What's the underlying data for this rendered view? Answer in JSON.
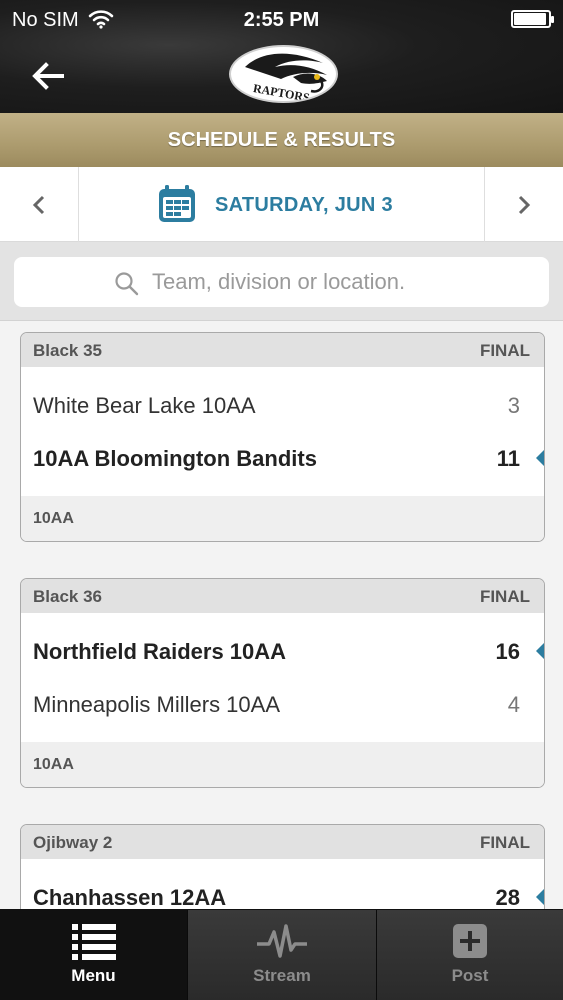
{
  "status_bar": {
    "carrier": "No SIM",
    "time": "2:55 PM",
    "battery_level": 0.9
  },
  "header": {
    "logo_text": "RAPTORS"
  },
  "title": "SCHEDULE & RESULTS",
  "date_nav": {
    "label": "SATURDAY, JUN 3"
  },
  "search": {
    "placeholder": "Team, division or location."
  },
  "games": [
    {
      "venue": "Black 35",
      "status": "FINAL",
      "division": "10AA",
      "teams": [
        {
          "name": "White Bear Lake 10AA",
          "score": "3",
          "winner": false
        },
        {
          "name": "10AA Bloomington Bandits",
          "score": "11",
          "winner": true
        }
      ]
    },
    {
      "venue": "Black 36",
      "status": "FINAL",
      "division": "10AA",
      "teams": [
        {
          "name": "Northfield Raiders 10AA",
          "score": "16",
          "winner": true
        },
        {
          "name": "Minneapolis Millers 10AA",
          "score": "4",
          "winner": false
        }
      ]
    },
    {
      "venue": "Ojibway 2",
      "status": "FINAL",
      "division": "",
      "teams": [
        {
          "name": "Chanhassen 12AA",
          "score": "28",
          "winner": true
        }
      ]
    }
  ],
  "tabs": [
    {
      "label": "Menu",
      "icon": "menu-list-icon",
      "active": true
    },
    {
      "label": "Stream",
      "icon": "pulse-icon",
      "active": false
    },
    {
      "label": "Post",
      "icon": "plus-box-icon",
      "active": false
    }
  ],
  "colors": {
    "accent": "#2c7da0",
    "gold": "#ae9d70",
    "tab_bg": "#2b2b2b"
  }
}
